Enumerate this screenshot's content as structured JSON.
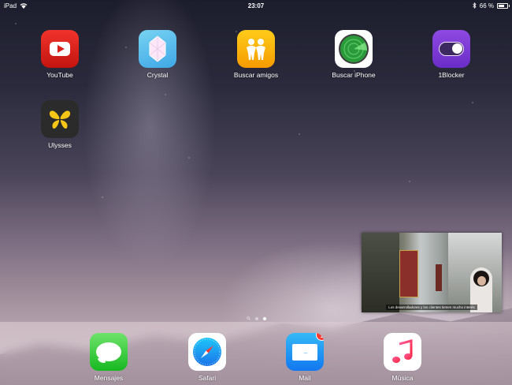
{
  "status_bar": {
    "device": "iPad",
    "time": "23:07",
    "battery_text": "66 %",
    "battery_level": 0.66
  },
  "home_apps": [
    {
      "label": "YouTube",
      "icon": "youtube-icon",
      "color": "#e62117"
    },
    {
      "label": "Crystal",
      "icon": "crystal-icon",
      "color": "#5bc2ef"
    },
    {
      "label": "Buscar amigos",
      "icon": "find-friends-icon",
      "color": "#fcb90f"
    },
    {
      "label": "Buscar iPhone",
      "icon": "find-iphone-icon",
      "color": "#ffffff"
    },
    {
      "label": "1Blocker",
      "icon": "1blocker-icon",
      "color": "#7b3fd8"
    },
    {
      "label": "Ulysses",
      "icon": "ulysses-icon",
      "color": "#2b2b2b"
    }
  ],
  "page_indicator": {
    "pages": 2,
    "active_page": 2
  },
  "dock": [
    {
      "label": "Mensajes",
      "icon": "messages-icon"
    },
    {
      "label": "Safari",
      "icon": "safari-icon"
    },
    {
      "label": "Mail",
      "icon": "mail-icon",
      "badge": "1"
    },
    {
      "label": "Música",
      "icon": "music-icon"
    }
  ],
  "pip_video": {
    "caption": "Los desarrolladores y los clientes tienen mucho interés"
  }
}
